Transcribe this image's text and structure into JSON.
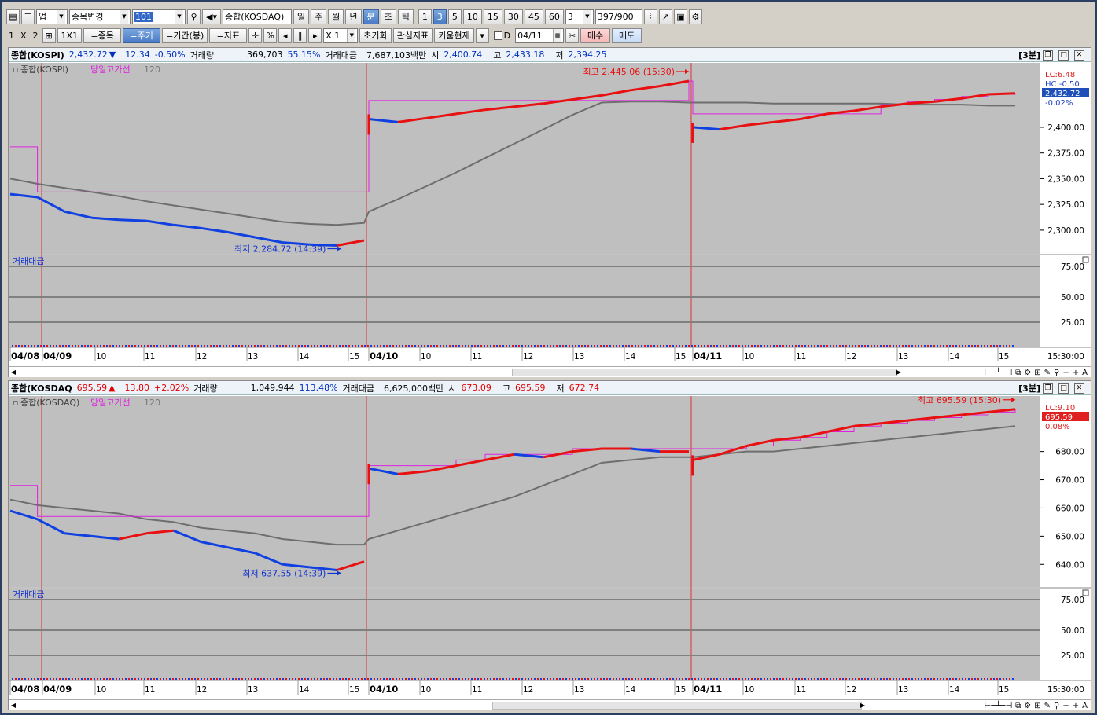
{
  "toolbar1": {
    "category": "업",
    "item_select": "종목변경",
    "code": "101",
    "index_name": "종합(KOSDAQ)",
    "periods": [
      "일",
      "주",
      "월",
      "년",
      "분",
      "초",
      "틱"
    ],
    "active_period": "분",
    "minutes": [
      "1",
      "3",
      "5",
      "10",
      "15",
      "30",
      "45",
      "60"
    ],
    "active_minute": "3",
    "interval_value": "3",
    "count": "397",
    "count_total": "/900"
  },
  "toolbar2": {
    "layout_items": [
      "1",
      "X",
      "2"
    ],
    "one_by_one": "1X1",
    "stock_btn": "=종목",
    "period_btn": "=주기",
    "range_btn": "=기간(봉)",
    "indicator_btn": "=지표",
    "percent": "%",
    "zoom": "X 1",
    "reset_btn": "초기화",
    "watch_btn": "관심지표",
    "kiwoom_btn": "키움현재",
    "d_label": "D",
    "date": "04/11",
    "buy_btn": "매수",
    "sell_btn": "매도"
  },
  "panels": [
    {
      "name": "종합(KOSPI)",
      "price": "2,432.72",
      "arrow": "▼",
      "change": "12.34",
      "pct": "-0.50%",
      "direction": "down",
      "vol_label": "거래량",
      "volume": "369,703",
      "vol_ratio": "55.15%",
      "amt_label": "거래대금",
      "amount": "7,687,103백만",
      "open_label": "시",
      "open": "2,400.74",
      "high_label": "고",
      "high": "2,433.18",
      "low_label": "저",
      "low": "2,394.25",
      "period_tag": "[3분]",
      "legend": {
        "index": "종합(KOSPI)",
        "line": "당일고가선",
        "ma": "120"
      },
      "sub_label": "거래대금",
      "right_labels": [
        "LC:6.48",
        "HC:-0.50",
        "2,432.72",
        "-0.02%"
      ],
      "y_ticks": [
        "2,400.00",
        "2,375.00",
        "2,350.00",
        "2,325.00",
        "2,300.00"
      ],
      "sub_ticks": [
        "75.00",
        "50.00",
        "25.00"
      ],
      "high_note": "최고 2,445.06 (15:30)",
      "low_note": "최저 2,284.72 (14:39)",
      "x_labels": [
        "04/08",
        "04/09",
        "10",
        "11",
        "12",
        "13",
        "14",
        "15",
        "04/10",
        "10",
        "11",
        "12",
        "13",
        "14",
        "15",
        "04/11",
        "10",
        "11",
        "12",
        "13",
        "14",
        "15"
      ],
      "time_label": "15:30:00",
      "chart_data": {
        "type": "line",
        "ylim": [
          2277,
          2458
        ],
        "close": [
          2335,
          2332,
          2318,
          2312,
          2310,
          2309,
          2305,
          2302,
          2298,
          2293,
          2288,
          2286,
          2285,
          2290,
          2408,
          2405,
          2409,
          2413,
          2417,
          2420,
          2423,
          2427,
          2431,
          2436,
          2440,
          2445,
          2400,
          2398,
          2402,
          2405,
          2408,
          2413,
          2416,
          2420,
          2423,
          2425,
          2428,
          2432,
          2433
        ],
        "ma120": [
          2350,
          2345,
          2341,
          2337,
          2333,
          2328,
          2324,
          2320,
          2316,
          2312,
          2308,
          2306,
          2305,
          2307,
          2318,
          2330,
          2343,
          2356,
          2370,
          2384,
          2398,
          2412,
          2424,
          2425,
          2425,
          2424,
          2424,
          2424,
          2424,
          2423,
          2423,
          2423,
          2423,
          2423,
          2422,
          2422,
          2422,
          2421,
          2421
        ],
        "day_high": [
          2381,
          2337,
          2337,
          2337,
          2337,
          2337,
          2337,
          2337,
          2337,
          2337,
          2337,
          2337,
          2337,
          2337,
          2426,
          2426,
          2426,
          2426,
          2426,
          2426,
          2426,
          2426,
          2426,
          2426,
          2426,
          2445,
          2413,
          2413,
          2413,
          2413,
          2413,
          2413,
          2413,
          2422,
          2425,
          2427,
          2430,
          2432,
          2433
        ]
      }
    },
    {
      "name": "종합(KOSDAQ",
      "price": "695.59",
      "arrow": "▲",
      "change": "13.80",
      "pct": "+2.02%",
      "direction": "up",
      "vol_label": "거래량",
      "volume": "1,049,944",
      "vol_ratio": "113.48%",
      "amt_label": "거래대금",
      "amount": "6,625,000백만",
      "open_label": "시",
      "open": "673.09",
      "high_label": "고",
      "high": "695.59",
      "low_label": "저",
      "low": "672.74",
      "period_tag": "[3분]",
      "legend": {
        "index": "종합(KOSDAQ)",
        "line": "당일고가선",
        "ma": "120"
      },
      "sub_label": "거래대금",
      "right_labels": [
        "LC:9.10",
        "695.59",
        "0.08%"
      ],
      "y_ticks": [
        "680.00",
        "670.00",
        "660.00",
        "650.00",
        "640.00"
      ],
      "sub_ticks": [
        "75.00",
        "50.00",
        "25.00"
      ],
      "high_note": "최고 695.59 (15:30)",
      "low_note": "최저 637.55 (14:39)",
      "x_labels": [
        "04/08",
        "04/09",
        "10",
        "11",
        "12",
        "13",
        "14",
        "15",
        "04/10",
        "10",
        "11",
        "12",
        "13",
        "14",
        "15",
        "04/11",
        "10",
        "11",
        "12",
        "13",
        "14",
        "15"
      ],
      "time_label": "15:30:00",
      "chart_data": {
        "type": "line",
        "ylim": [
          632,
          698
        ],
        "close": [
          659,
          656,
          651,
          650,
          649,
          651,
          652,
          648,
          646,
          644,
          640,
          639,
          638,
          641,
          674,
          672,
          673,
          675,
          677,
          679,
          678,
          680,
          681,
          681,
          680,
          680,
          677,
          679,
          682,
          684,
          685,
          687,
          689,
          690,
          691,
          692,
          693,
          694,
          695
        ],
        "ma120": [
          663,
          661,
          660,
          659,
          658,
          656,
          655,
          653,
          652,
          651,
          649,
          648,
          647,
          647,
          649,
          652,
          655,
          658,
          661,
          664,
          668,
          672,
          676,
          677,
          678,
          678,
          678,
          679,
          680,
          680,
          681,
          682,
          683,
          684,
          685,
          686,
          687,
          688,
          689
        ],
        "day_high": [
          668,
          657,
          657,
          657,
          657,
          657,
          657,
          657,
          657,
          657,
          657,
          657,
          657,
          657,
          675,
          675,
          675,
          677,
          679,
          679,
          679,
          681,
          681,
          681,
          681,
          681,
          681,
          681,
          682,
          684,
          685,
          687,
          689,
          690,
          691,
          692,
          693,
          694,
          695
        ]
      }
    }
  ]
}
